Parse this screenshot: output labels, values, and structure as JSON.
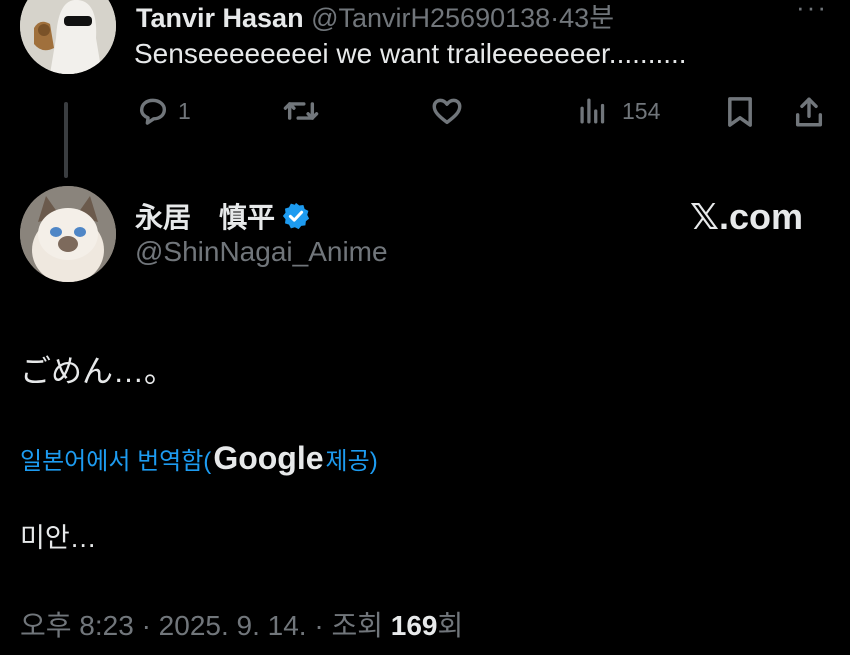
{
  "reply": {
    "author_name": "Tanvir Hasan",
    "author_handle": "@TanvirH25690138",
    "separator": "·",
    "time": "43분",
    "text": "Senseeeeeeeei we want traileeeeeeer..........",
    "replies": "1",
    "views": "154",
    "more_icon": "ellipsis-icon"
  },
  "main": {
    "author_name": "永居　慎平",
    "author_handle": "@ShinNagai_Anime",
    "verified": true,
    "verified_color": "#1d9bf0",
    "watermark": "𝕏.com",
    "text": "ごめん…。",
    "translate_prefix": "일본어에서 번역함(",
    "translate_provider": "Google",
    "translate_suffix": " 제공)",
    "translated_text": "미안…",
    "meta_time": "오후 8:23 · 2025. 9. 14. · 조회 ",
    "meta_views": "169",
    "meta_views_suffix": "회"
  },
  "colors": {
    "background": "#000000",
    "text": "#e7e9ea",
    "muted": "#71767b",
    "link": "#1d9bf0"
  }
}
